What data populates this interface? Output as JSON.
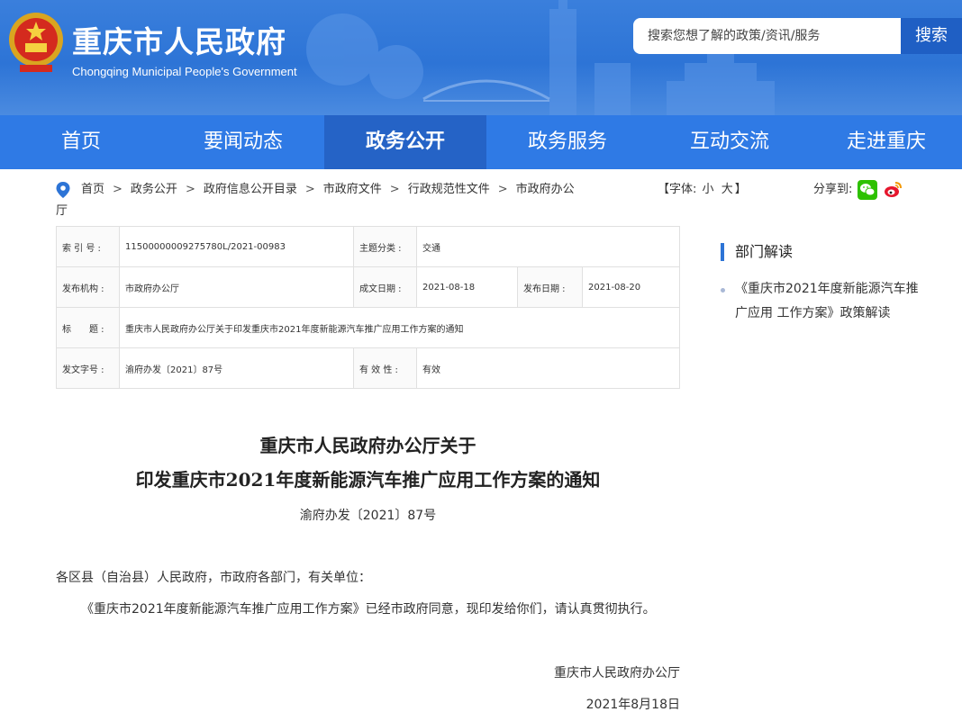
{
  "header": {
    "site_title": "重庆市人民政府",
    "site_subtitle": "Chongqing Municipal People's Government",
    "search_placeholder": "搜索您想了解的政策/资讯/服务",
    "search_button": "搜索"
  },
  "nav": {
    "items": [
      {
        "label": "首页"
      },
      {
        "label": "要闻动态"
      },
      {
        "label": "政务公开"
      },
      {
        "label": "政务服务"
      },
      {
        "label": "互动交流"
      },
      {
        "label": "走进重庆"
      }
    ],
    "active": "政务公开"
  },
  "breadcrumb": {
    "items": [
      "首页",
      "政务公开",
      "政府信息公开目录",
      "市政府文件",
      "行政规范性文件",
      "市政府办公厅"
    ],
    "separator": ">"
  },
  "font_size": {
    "prefix": "【字体:",
    "small": "小",
    "large": "大",
    "suffix": "】"
  },
  "share": {
    "label": "分享到:",
    "icons": [
      "wechat-icon",
      "weibo-icon"
    ]
  },
  "meta": {
    "index_label": "索 引 号 :",
    "index_value": "11500000009275780L/2021-00983",
    "subject_label": "主题分类 :",
    "subject_value": "交通",
    "publisher_label": "发布机构 :",
    "publisher_value": "市政府办公厅",
    "created_label": "成文日期 :",
    "created_value": "2021-08-18",
    "published_label": "发布日期 :",
    "published_value": "2021-08-20",
    "title_label": "标　　题 :",
    "title_value": "重庆市人民政府办公厅关于印发重庆市2021年度新能源汽车推广应用工作方案的通知",
    "docno_label": "发文字号 :",
    "docno_value": "渝府办发〔2021〕87号",
    "validity_label": "有 效 性 :",
    "validity_value": "有效"
  },
  "article": {
    "title_line1": "重庆市人民政府办公厅关于",
    "title_line2": "印发重庆市2021年度新能源汽车推广应用工作方案的通知",
    "doc_number": "渝府办发〔2021〕87号",
    "salutation": "各区县（自治县）人民政府，市政府各部门，有关单位：",
    "body": "《重庆市2021年度新能源汽车推广应用工作方案》已经市政府同意，现印发给你们，请认真贯彻执行。",
    "issuer": "重庆市人民政府办公厅",
    "date": "2021年8月18日"
  },
  "sidebar": {
    "heading": "部门解读",
    "item": "《重庆市2021年度新能源汽车推广应用 工作方案》政策解读"
  },
  "colors": {
    "header_blue": "#2d74d6",
    "nav_blue": "#2f7ae5",
    "nav_active": "#2563c6"
  }
}
